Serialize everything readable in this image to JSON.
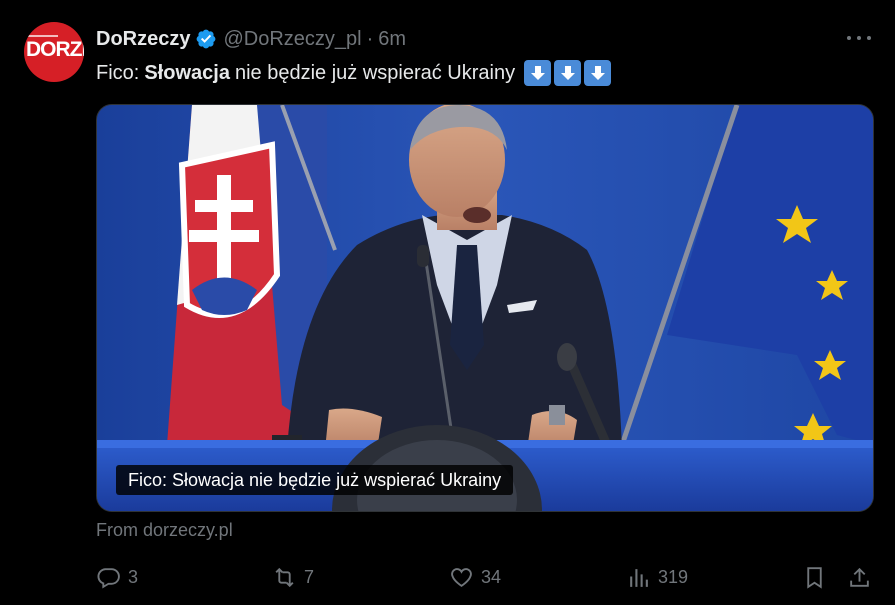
{
  "author": {
    "avatar_text": "DORZE",
    "name": "DoRzeczy",
    "handle": "@DoRzeczy_pl",
    "separator": "·",
    "time": "6m"
  },
  "tweet": {
    "text_before": "Fico:",
    "text_bold": "Słowacja",
    "text_after": "nie będzie już wspierać Ukrainy",
    "emoji": [
      "down-arrow-emoji",
      "down-arrow-emoji",
      "down-arrow-emoji"
    ]
  },
  "media": {
    "caption": "Fico: Słowacja nie będzie już wspierać Ukrainy"
  },
  "source": "From dorzeczy.pl",
  "actions": {
    "replies": "3",
    "retweets": "7",
    "likes": "34",
    "views": "319"
  },
  "colors": {
    "background": "#000000",
    "text": "#e7e9ea",
    "muted": "#71767b",
    "verified": "#1d9bf0",
    "brand": "#d61f26"
  }
}
